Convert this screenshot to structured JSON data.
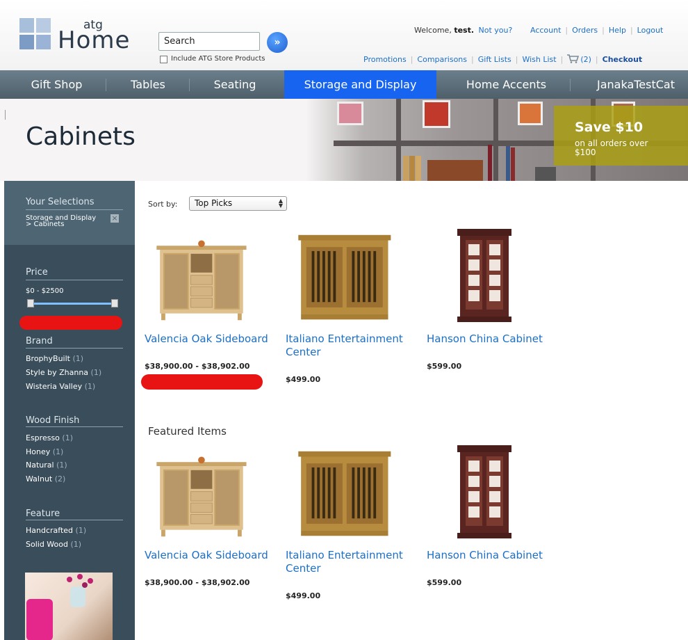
{
  "header": {
    "logo_atg": "atg",
    "logo_home": "Home",
    "search_value": "Search",
    "include_label": "Include ATG Store Products",
    "welcome_prefix": "Welcome,",
    "welcome_user": "test.",
    "not_you": "Not you?",
    "util_links": [
      "Account",
      "Orders",
      "Help",
      "Logout"
    ],
    "sub_links": [
      "Promotions",
      "Comparisons",
      "Gift Lists",
      "Wish List"
    ],
    "cart_count": "(2)",
    "checkout": "Checkout"
  },
  "nav": {
    "items": [
      "Gift Shop",
      "Tables",
      "Seating",
      "Storage and Display",
      "Home Accents",
      "JanakaTestCat"
    ],
    "active": "Storage and Display"
  },
  "banner": {
    "title": "Cabinets",
    "promo_big": "Save $10",
    "promo_small": "on all orders over $100"
  },
  "sidebar": {
    "selections_title": "Your Selections",
    "selection_crumb": "Storage and Display > Cabinets",
    "price_title": "Price",
    "price_range": "$0 - $2500",
    "brand_title": "Brand",
    "brands": [
      {
        "name": "BrophyBuilt",
        "count": "(1)"
      },
      {
        "name": "Style by Zhanna",
        "count": "(1)"
      },
      {
        "name": "Wisteria Valley",
        "count": "(1)"
      }
    ],
    "wood_title": "Wood Finish",
    "woods": [
      {
        "name": "Espresso",
        "count": "(1)"
      },
      {
        "name": "Honey",
        "count": "(1)"
      },
      {
        "name": "Natural",
        "count": "(1)"
      },
      {
        "name": "Walnut",
        "count": "(2)"
      }
    ],
    "feature_title": "Feature",
    "features": [
      {
        "name": "Handcrafted",
        "count": "(1)"
      },
      {
        "name": "Solid Wood",
        "count": "(1)"
      }
    ]
  },
  "main": {
    "sort_label": "Sort by:",
    "sort_value": "Top Picks",
    "featured_title": "Featured Items",
    "products": [
      {
        "name": "Valencia Oak Sideboard",
        "price": "$38,900.00 - $38,902.00"
      },
      {
        "name": "Italiano Entertainment Center",
        "price": "$499.00"
      },
      {
        "name": "Hanson China Cabinet",
        "price": "$599.00"
      }
    ],
    "featured": [
      {
        "name": "Valencia Oak Sideboard",
        "price": "$38,900.00 - $38,902.00"
      },
      {
        "name": "Italiano Entertainment Center",
        "price": "$499.00"
      },
      {
        "name": "Hanson China Cabinet",
        "price": "$599.00"
      }
    ]
  },
  "colors": {
    "nav_active": "#1764f0",
    "link": "#1a6fc9",
    "sidebar": "#3a4d5a",
    "promo": "#aaa014"
  }
}
